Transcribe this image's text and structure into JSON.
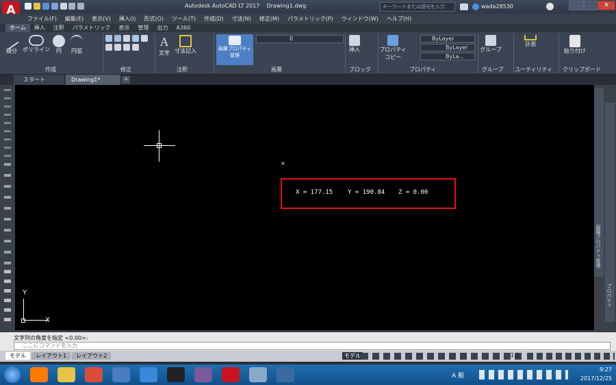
{
  "window": {
    "title": "Autodesk AutoCAD LT 2017",
    "doc": "Drawing1.dwg",
    "search_placeholder": "キーワードまたは語句を入力",
    "user": "wada28530"
  },
  "menus": [
    "ファイル(F)",
    "編集(E)",
    "表示(V)",
    "挿入(I)",
    "形式(O)",
    "ツール(T)",
    "作成(D)",
    "寸法(N)",
    "修正(M)",
    "パラメトリック(P)",
    "ウィンドウ(W)",
    "ヘルプ(H)"
  ],
  "ribbon_tabs": [
    "ホーム",
    "挿入",
    "注釈",
    "パラメトリック",
    "表示",
    "管理",
    "出力",
    "A360"
  ],
  "ribbon": {
    "draw": {
      "line": "線分",
      "polyline": "ポリライン",
      "circle": "円",
      "arc": "円弧",
      "title": "作成"
    },
    "modify_title": "修正",
    "annot": {
      "text": "文字",
      "dim": "寸法記入",
      "title": "注釈"
    },
    "layer": {
      "btn1": "画層プロパティ",
      "btn2": "管理",
      "current": "0",
      "title": "画層"
    },
    "block": {
      "insert": "挿入",
      "title": "ブロック"
    },
    "props": {
      "copy1": "プロパティ",
      "copy2": "コピー",
      "v1": "ByLayer",
      "v2": "ByLayer",
      "v3": "ByLa...",
      "title": "プロパティ"
    },
    "group": {
      "label": "グループ",
      "title": "グループ"
    },
    "util": {
      "label": "計測",
      "title": "ユーティリティ"
    },
    "clip": {
      "label": "貼り付け",
      "title": "クリップボード"
    }
  },
  "file_tabs": [
    {
      "label": "スタート"
    },
    {
      "label": "Drawing1*"
    }
  ],
  "coords": {
    "x": "X = 177.15",
    "y": "Y = 190.84",
    "z": "Z = 0.00"
  },
  "ucs": {
    "x": "X",
    "y": "Y"
  },
  "palette_labels": {
    "layer": "画層プロパティ管理",
    "props": "プロパティ"
  },
  "command": {
    "history": "文字列の角度を指定 <0.00>:",
    "placeholder": "ここにコマンドを入力"
  },
  "layout_tabs": [
    "モデル",
    "レイアウト1",
    "レイアウト2"
  ],
  "status": {
    "model": "モデル",
    "scale": "1:1"
  },
  "tray": {
    "ime": "A 般",
    "time": "9:27",
    "date": "2017/12/25"
  },
  "colors": {
    "accent": "#1f6fb0",
    "coord_box": "#e81010"
  }
}
